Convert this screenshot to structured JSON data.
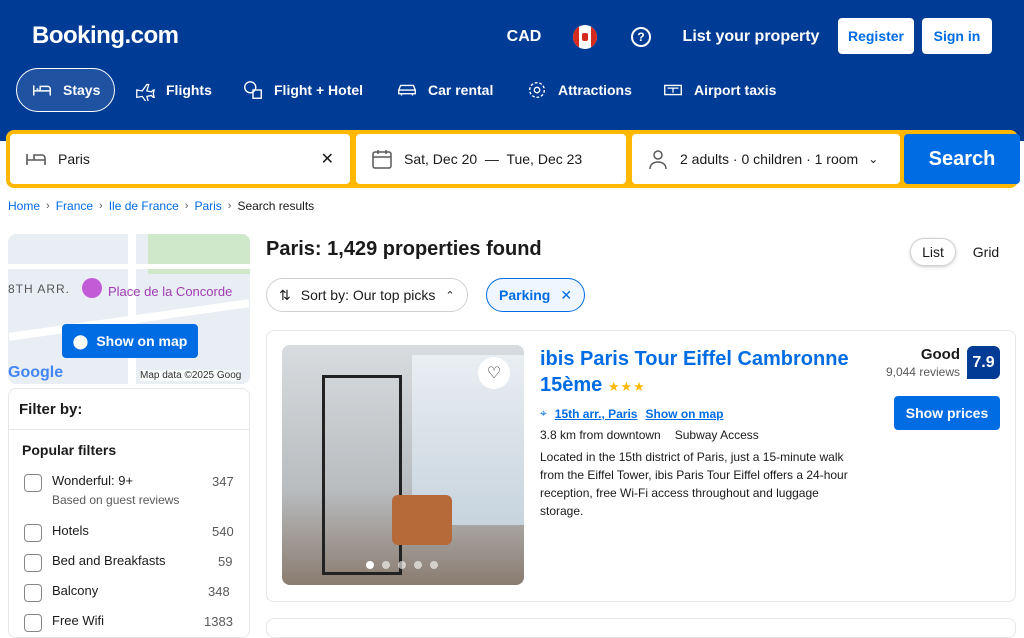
{
  "header": {
    "logo": "Booking.com",
    "currency": "CAD",
    "help": "?",
    "list_property": "List your property",
    "register": "Register",
    "sign_in": "Sign in",
    "nav": [
      {
        "label": "Stays",
        "icon": "bed-icon"
      },
      {
        "label": "Flights",
        "icon": "plane-icon"
      },
      {
        "label": "Flight + Hotel",
        "icon": "flight-hotel-icon"
      },
      {
        "label": "Car rental",
        "icon": "car-icon"
      },
      {
        "label": "Attractions",
        "icon": "attractions-icon"
      },
      {
        "label": "Airport taxis",
        "icon": "taxi-icon"
      }
    ]
  },
  "search": {
    "destination": "Paris",
    "dates": "Sat, Dec 20  —  Tue, Dec 23",
    "guests": "2 adults · 0 children · 1 room",
    "button": "Search"
  },
  "breadcrumbs": [
    "Home",
    "France",
    "Ile de France",
    "Paris",
    "Search results"
  ],
  "map": {
    "place_label": "Place de la Concorde",
    "area_label": "8TH ARR.",
    "show_on_map": "Show on map",
    "google": "Google",
    "credit": "Map data ©2025 Goog"
  },
  "filters": {
    "heading": "Filter by:",
    "section": "Popular filters",
    "items": [
      {
        "label": "Wonderful: 9+",
        "sub": "Based on guest reviews",
        "count": "347"
      },
      {
        "label": "Hotels",
        "count": "540"
      },
      {
        "label": "Bed and Breakfasts",
        "count": "59"
      },
      {
        "label": "Balcony",
        "count": "348"
      },
      {
        "label": "Free Wifi",
        "count": "1383"
      }
    ]
  },
  "results": {
    "title": "Paris: 1,429 properties found",
    "list": "List",
    "grid": "Grid",
    "sort": "Sort by: Our top picks",
    "parking": "Parking"
  },
  "property": {
    "name_line1": "ibis Paris Tour Eiffel Cambronne",
    "name_line2": "15ème",
    "stars": "★★★",
    "area": "15th arr., Paris",
    "show_on_map": "Show on map",
    "distance": "3.8 km from downtown",
    "subway": "Subway Access",
    "description": "Located in the 15th district of Paris, just a 15-minute walk from the Eiffel Tower, ibis Paris Tour Eiffel offers a 24-hour reception, free Wi-Fi access throughout and luggage storage.",
    "rating_word": "Good",
    "reviews": "9,044 reviews",
    "score": "7.9",
    "show_prices": "Show prices"
  },
  "colors": {
    "brand": "#003b95",
    "accent": "#006ce4",
    "highlight": "#ffb700"
  }
}
